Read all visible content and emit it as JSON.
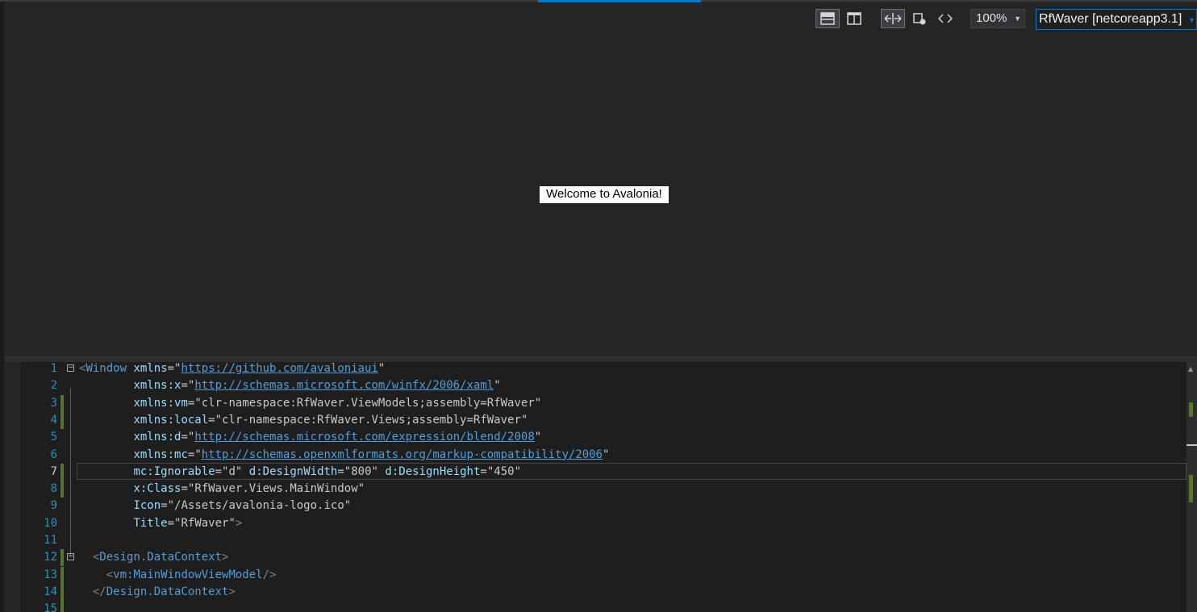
{
  "toolbar": {
    "layout_horizontal_icon": "split-horizontal-icon",
    "layout_vertical_icon": "split-vertical-icon",
    "swap_icon": "swap-panes-icon",
    "selection_icon": "selection-icon",
    "code_icon": "code-icon",
    "zoom": "100%",
    "project": "RfWaver [netcoreapp3.1]"
  },
  "canvas": {
    "welcome_text": "Welcome to Avalonia!"
  },
  "editor": {
    "current_line": 7,
    "lines": [
      {
        "num": "1",
        "text": "<Window xmlns=\"https://github.com/avaloniaui\""
      },
      {
        "num": "2",
        "text": "        xmlns:x=\"http://schemas.microsoft.com/winfx/2006/xaml\""
      },
      {
        "num": "3",
        "text": "        xmlns:vm=\"clr-namespace:RfWaver.ViewModels;assembly=RfWaver\""
      },
      {
        "num": "4",
        "text": "        xmlns:local=\"clr-namespace:RfWaver.Views;assembly=RfWaver\""
      },
      {
        "num": "5",
        "text": "        xmlns:d=\"http://schemas.microsoft.com/expression/blend/2008\""
      },
      {
        "num": "6",
        "text": "        xmlns:mc=\"http://schemas.openxmlformats.org/markup-compatibility/2006\""
      },
      {
        "num": "7",
        "text": "        mc:Ignorable=\"d\" d:DesignWidth=\"800\" d:DesignHeight=\"450\""
      },
      {
        "num": "8",
        "text": "        x:Class=\"RfWaver.Views.MainWindow\""
      },
      {
        "num": "9",
        "text": "        Icon=\"/Assets/avalonia-logo.ico\""
      },
      {
        "num": "10",
        "text": "        Title=\"RfWaver\">"
      },
      {
        "num": "11",
        "text": ""
      },
      {
        "num": "12",
        "text": "  <Design.DataContext>"
      },
      {
        "num": "13",
        "text": "    <vm:MainWindowViewModel/>"
      },
      {
        "num": "14",
        "text": "  </Design.DataContext>"
      },
      {
        "num": "15",
        "text": ""
      }
    ]
  },
  "colors": {
    "editor_bg": "#1e1e1e",
    "panel_bg": "#252526",
    "accent": "#007acc",
    "line_number": "#2b91af",
    "element": "#569cd6",
    "attribute": "#9cdcfe",
    "change_marker": "#577430"
  }
}
